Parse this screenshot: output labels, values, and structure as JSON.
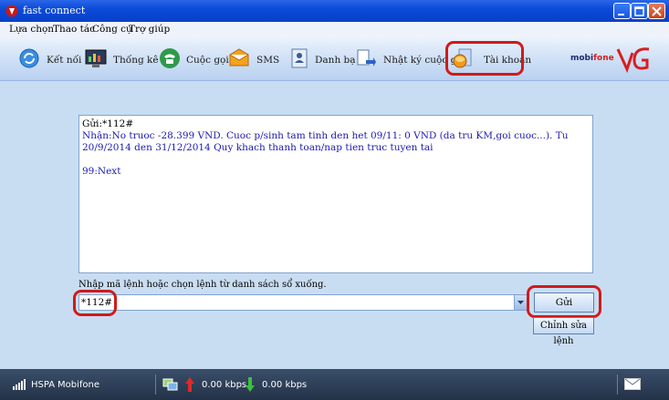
{
  "window": {
    "title": "fast connect"
  },
  "menu": [
    "Lựa chọn",
    "Thao tác",
    "Công cụ",
    "Trợ giúp"
  ],
  "toolbar": {
    "connect": "Kết nối",
    "stats": "Thống kê",
    "calls": "Cuộc gọi",
    "sms": "SMS",
    "contacts": "Danh bạ",
    "call_log": "Nhật ký cuộc gọi",
    "account": "Tài khoản",
    "brand_mobi": "mobi",
    "brand_fone": "fone"
  },
  "output": {
    "sent": "Gửi:*112#",
    "received": "Nhận:No truoc -28.399 VND. Cuoc p/sinh tam tinh den het 09/11: 0 VND (da tru KM,goi cuoc...). Tu 20/9/2014 den 31/12/2014 Quy khach thanh toan/nap tien truc tuyen tai",
    "next": "99:Next"
  },
  "command": {
    "hint": "Nhập mã lệnh hoặc chọn lệnh từ danh sách sổ xuống.",
    "value": "*112#",
    "send_label": "Gửi",
    "edit_label": "Chỉnh sửa lệnh"
  },
  "status": {
    "network": "HSPA",
    "operator": "Mobifone",
    "upload": "0.00 kbps",
    "download": "0.00 kbps"
  },
  "colors": {
    "highlight": "#d01a1a",
    "received_text": "#1a1ab4"
  }
}
